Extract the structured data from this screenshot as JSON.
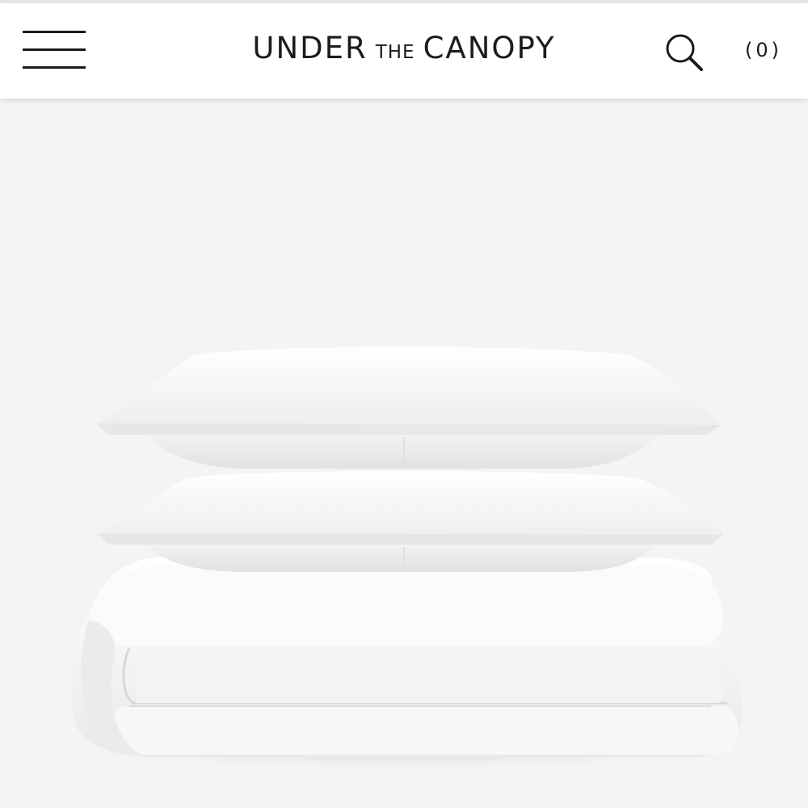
{
  "header": {
    "brand": {
      "word1": "UNDER",
      "word2": "THE",
      "word3": "CANOPY"
    },
    "menu_icon": "hamburger-menu-icon",
    "search_icon": "search-icon",
    "cart_count": "(0)"
  },
  "hero": {
    "product_image": "stacked white pillows and folded duvet",
    "background_color": "#f4f4f4"
  },
  "colors": {
    "header_bg": "#ffffff",
    "text": "#1c1c1c",
    "page_bg": "#f4f4f4"
  }
}
